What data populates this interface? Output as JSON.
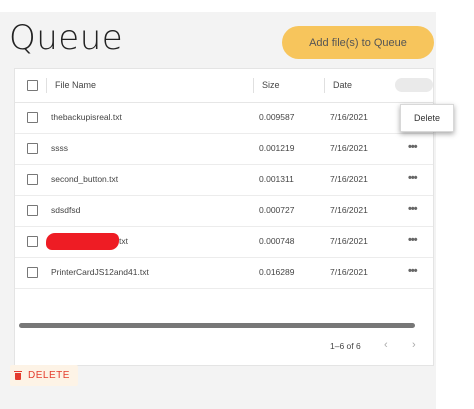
{
  "page": {
    "title": "Queue"
  },
  "toolbar": {
    "add_label": "Add file(s) to Queue"
  },
  "table": {
    "headers": {
      "name": "File Name",
      "size": "Size",
      "date": "Date"
    },
    "rows": [
      {
        "name": "thebackupisreal.txt",
        "size": "0.009587",
        "date": "7/16/2021",
        "redacted": false
      },
      {
        "name": "ssss",
        "size": "0.001219",
        "date": "7/16/2021",
        "redacted": false
      },
      {
        "name": "second_button.txt",
        "size": "0.001311",
        "date": "7/16/2021",
        "redacted": false
      },
      {
        "name": "sdsdfsd",
        "size": "0.000727",
        "date": "7/16/2021",
        "redacted": false
      },
      {
        "name": "txt",
        "size": "0.000748",
        "date": "7/16/2021",
        "redacted": true
      },
      {
        "name": "PrinterCardJS12and41.txt",
        "size": "0.016289",
        "date": "7/16/2021",
        "redacted": false
      }
    ],
    "row_menu_glyph": "•••",
    "redaction_color": "#ee1c24"
  },
  "pagination": {
    "range": "1–6 of 6",
    "prev_glyph": "‹",
    "next_glyph": "›"
  },
  "context_menu": {
    "delete_label": "Delete"
  },
  "bulk_actions": {
    "delete_label": "DELETE",
    "icon": "trash-icon"
  },
  "colors": {
    "accent": "#f7c55c",
    "danger": "#e43b2c"
  }
}
